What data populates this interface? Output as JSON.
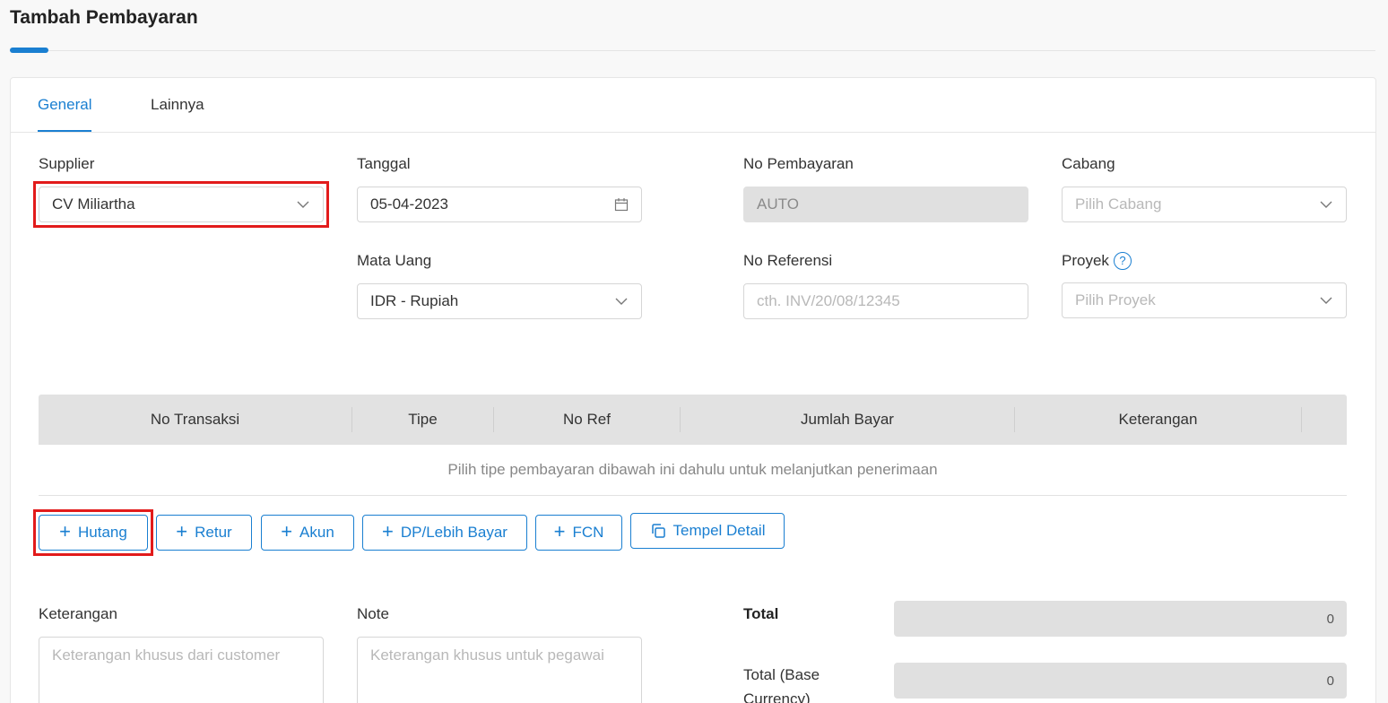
{
  "page": {
    "title": "Tambah Pembayaran"
  },
  "tabs": [
    {
      "label": "General",
      "active": true
    },
    {
      "label": "Lainnya",
      "active": false
    }
  ],
  "form": {
    "supplier": {
      "label": "Supplier",
      "value": "CV Miliartha"
    },
    "tanggal": {
      "label": "Tanggal",
      "value": "05-04-2023"
    },
    "no_pembayaran": {
      "label": "No Pembayaran",
      "value": "AUTO"
    },
    "cabang": {
      "label": "Cabang",
      "placeholder": "Pilih Cabang"
    },
    "mata_uang": {
      "label": "Mata Uang",
      "value": "IDR - Rupiah"
    },
    "no_referensi": {
      "label": "No Referensi",
      "placeholder": "cth. INV/20/08/12345"
    },
    "proyek": {
      "label": "Proyek",
      "placeholder": "Pilih Proyek"
    }
  },
  "table": {
    "columns": [
      "No Transaksi",
      "Tipe",
      "No Ref",
      "Jumlah Bayar",
      "Keterangan"
    ],
    "empty_message": "Pilih tipe pembayaran dibawah ini dahulu untuk melanjutkan penerimaan"
  },
  "buttons": {
    "hutang": "Hutang",
    "retur": "Retur",
    "akun": "Akun",
    "dp": "DP/Lebih Bayar",
    "fcn": "FCN",
    "tempel": "Tempel Detail"
  },
  "notes": {
    "keterangan": {
      "label": "Keterangan",
      "placeholder": "Keterangan khusus dari customer"
    },
    "note": {
      "label": "Note",
      "placeholder": "Keterangan khusus untuk pegawai"
    }
  },
  "totals": {
    "total_label": "Total",
    "total_value": "0",
    "base_label_line1": "Total (Base",
    "base_label_line2": "Currency)",
    "base_value": "0"
  },
  "colors": {
    "accent": "#1a7fd1",
    "highlight": "#e21b1b"
  }
}
